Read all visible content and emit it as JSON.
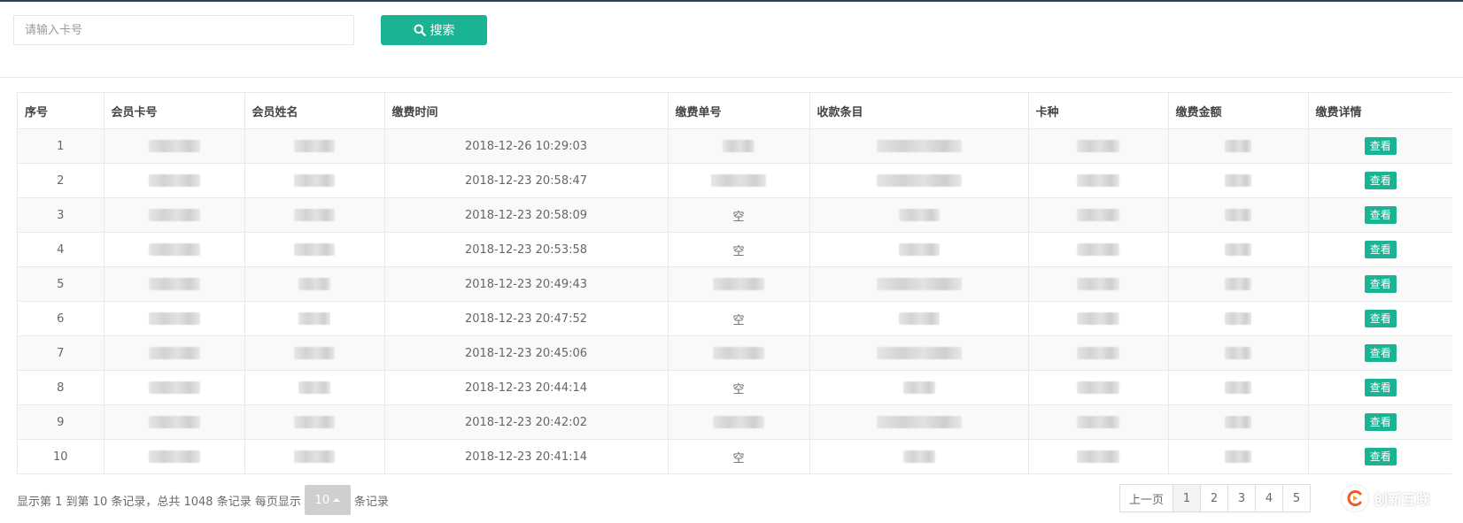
{
  "search": {
    "placeholder": "请输入卡号",
    "button_label": "搜索"
  },
  "table": {
    "columns": [
      "序号",
      "会员卡号",
      "会员姓名",
      "缴费时间",
      "缴费单号",
      "收款条目",
      "卡种",
      "缴费金额",
      "缴费详情"
    ],
    "rows": [
      {
        "index": "1",
        "time": "2018-12-26 10:29:03",
        "order_no": "",
        "action": "查看"
      },
      {
        "index": "2",
        "time": "2018-12-23 20:58:47",
        "order_no": "",
        "action": "查看"
      },
      {
        "index": "3",
        "time": "2018-12-23 20:58:09",
        "order_no": "空",
        "action": "查看"
      },
      {
        "index": "4",
        "time": "2018-12-23 20:53:58",
        "order_no": "空",
        "action": "查看"
      },
      {
        "index": "5",
        "time": "2018-12-23 20:49:43",
        "order_no": "",
        "action": "查看"
      },
      {
        "index": "6",
        "time": "2018-12-23 20:47:52",
        "order_no": "空",
        "action": "查看"
      },
      {
        "index": "7",
        "time": "2018-12-23 20:45:06",
        "order_no": "",
        "action": "查看"
      },
      {
        "index": "8",
        "time": "2018-12-23 20:44:14",
        "order_no": "空",
        "action": "查看"
      },
      {
        "index": "9",
        "time": "2018-12-23 20:42:02",
        "order_no": "",
        "action": "查看"
      },
      {
        "index": "10",
        "time": "2018-12-23 20:41:14",
        "order_no": "空",
        "action": "查看"
      }
    ]
  },
  "footer": {
    "info_prefix": "显示第 1 到第 10 条记录，总共 1048 条记录 每页显示",
    "page_size": "10",
    "info_suffix": "条记录"
  },
  "pagination": {
    "prev_label": "上一页",
    "pages": [
      "1",
      "2",
      "3",
      "4",
      "5"
    ],
    "active_page": "1"
  },
  "watermark": {
    "text": "创新互联"
  },
  "colors": {
    "accent": "#1ab394",
    "topline": "#2f4050"
  }
}
